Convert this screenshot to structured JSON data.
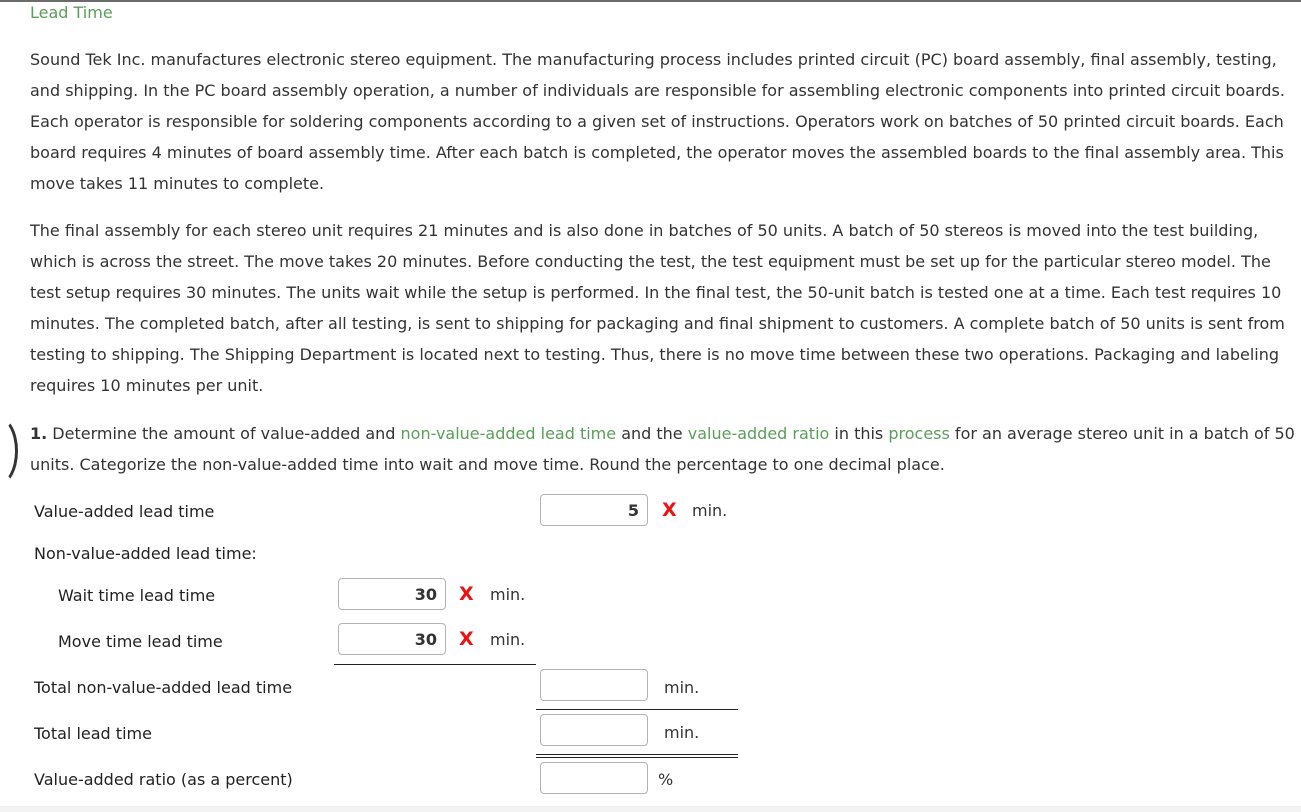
{
  "header": {
    "title": "Lead Time"
  },
  "problem": {
    "paragraph1": "Sound Tek Inc. manufactures electronic stereo equipment. The manufacturing process includes printed circuit (PC) board assembly, final assembly, testing, and shipping. In the PC board assembly operation, a number of individuals are responsible for assembling electronic components into printed circuit boards. Each operator is responsible for soldering components according to a given set of instructions. Operators work on batches of 50 printed circuit boards. Each board requires 4 minutes of board assembly time. After each batch is completed, the operator moves the assembled boards to the final assembly area. This move takes 11 minutes to complete.",
    "paragraph2": "The final assembly for each stereo unit requires 21 minutes and is also done in batches of 50 units. A batch of 50 stereos is moved into the test building, which is across the street. The move takes 20 minutes. Before conducting the test, the test equipment must be set up for the particular stereo model. The test setup requires 30 minutes. The units wait while the setup is performed. In the final test, the 50-unit batch is tested one at a time. Each test requires 10 minutes. The completed batch, after all testing, is sent to shipping for packaging and final shipment to customers. A complete batch of 50 units is sent from testing to shipping. The Shipping Department is located next to testing. Thus, there is no move time between these two operations. Packaging and labeling requires 10 minutes per unit."
  },
  "question": {
    "number": "1.",
    "text_part1": " Determine the amount of value-added and ",
    "link1": "non-value-added lead time",
    "text_part2": " and the ",
    "link2": "value-added ratio",
    "text_part3": " in this ",
    "link3": "process",
    "text_part4": " for an average stereo unit in a batch of 50 units. Categorize the non-value-added time into wait and move time. Round the percentage to one decimal place."
  },
  "form": {
    "value_added": {
      "label": "Value-added lead time",
      "value": "5",
      "status": "incorrect",
      "mark": "X",
      "unit": "min."
    },
    "non_value_added_heading": "Non-value-added lead time:",
    "wait_time": {
      "label": "Wait time lead time",
      "value": "30",
      "status": "incorrect",
      "mark": "X",
      "unit": "min."
    },
    "move_time": {
      "label": "Move time lead time",
      "value": "30",
      "status": "incorrect",
      "mark": "X",
      "unit": "min."
    },
    "total_nva": {
      "label": "Total non-value-added lead time",
      "value": "",
      "unit": "min."
    },
    "total_lead": {
      "label": "Total lead time",
      "value": "",
      "unit": "min."
    },
    "va_ratio": {
      "label": "Value-added ratio (as a percent)",
      "value": "",
      "unit": "%"
    }
  },
  "colors": {
    "accent_green": "#5a9e5a",
    "incorrect_red": "#ee1111"
  }
}
